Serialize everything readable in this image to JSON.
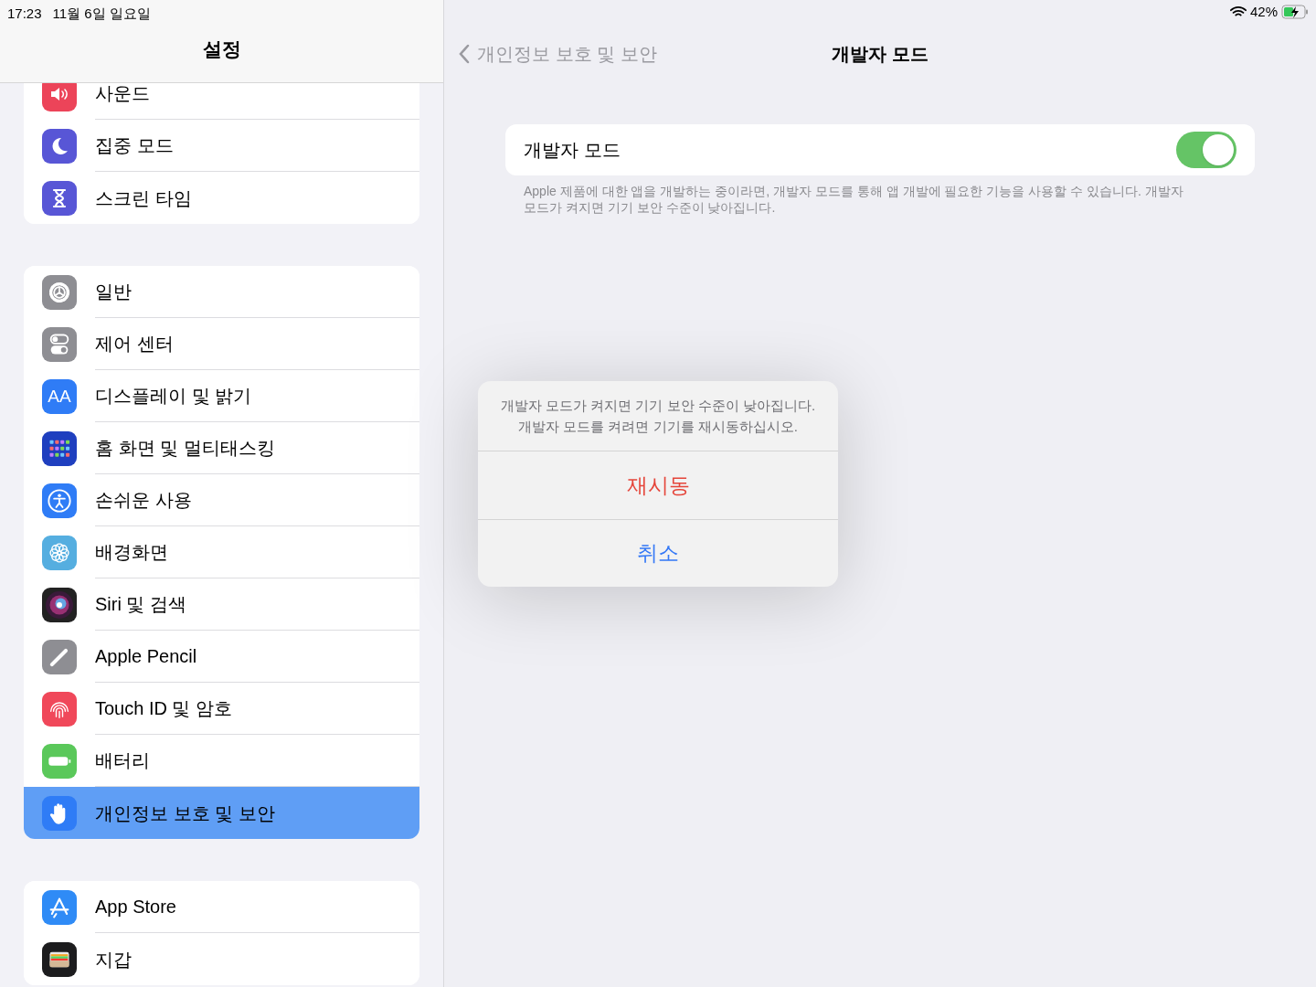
{
  "status_bar": {
    "time": "17:23",
    "date": "11월 6일 일요일",
    "battery": "42%"
  },
  "sidebar": {
    "title": "설정",
    "groups": [
      {
        "items": [
          {
            "label": "사운드",
            "kind": "sound",
            "selected": false
          },
          {
            "label": "집중 모드",
            "kind": "moon",
            "selected": false
          },
          {
            "label": "스크린 타임",
            "kind": "hourglass",
            "selected": false
          }
        ]
      },
      {
        "items": [
          {
            "label": "일반",
            "kind": "gear",
            "selected": false
          },
          {
            "label": "제어 센터",
            "kind": "toggles",
            "selected": false
          },
          {
            "label": "디스플레이 및 밝기",
            "kind": "text",
            "icon_text": "AA",
            "selected": false
          },
          {
            "label": "홈 화면 및 멀티태스킹",
            "kind": "grid",
            "selected": false
          },
          {
            "label": "손쉬운 사용",
            "kind": "accessibility",
            "selected": false
          },
          {
            "label": "배경화면",
            "kind": "flower",
            "selected": false
          },
          {
            "label": "Siri 및 검색",
            "kind": "siri",
            "selected": false
          },
          {
            "label": "Apple Pencil",
            "kind": "pencil",
            "selected": false
          },
          {
            "label": "Touch ID 및 암호",
            "kind": "fingerprint",
            "selected": false
          },
          {
            "label": "배터리",
            "kind": "battery",
            "selected": false
          },
          {
            "label": "개인정보 보호 및 보안",
            "kind": "hand",
            "selected": true
          }
        ]
      },
      {
        "items": [
          {
            "label": "App Store",
            "kind": "appstore",
            "selected": false
          },
          {
            "label": "지갑",
            "kind": "wallet",
            "selected": false
          }
        ]
      }
    ]
  },
  "detail": {
    "back": "개인정보 보호 및 보안",
    "title": "개발자 모드",
    "toggle": {
      "label": "개발자 모드",
      "on": true
    },
    "footer": "Apple 제품에 대한 앱을 개발하는 중이라면, 개발자 모드를 통해 앱 개발에 필요한 기능을 사용할 수 있습니다. 개발자 모드가 켜지면 기기 보안 수준이 낮아집니다."
  },
  "alert": {
    "message": "개발자 모드가 켜지면 기기 보안 수준이 낮아집니다.\n개발자 모드를 켜려면 기기를 재시동하십시오.",
    "buttons": [
      {
        "label": "재시동",
        "kind": "destructive"
      },
      {
        "label": "취소",
        "kind": "cancel"
      }
    ]
  }
}
